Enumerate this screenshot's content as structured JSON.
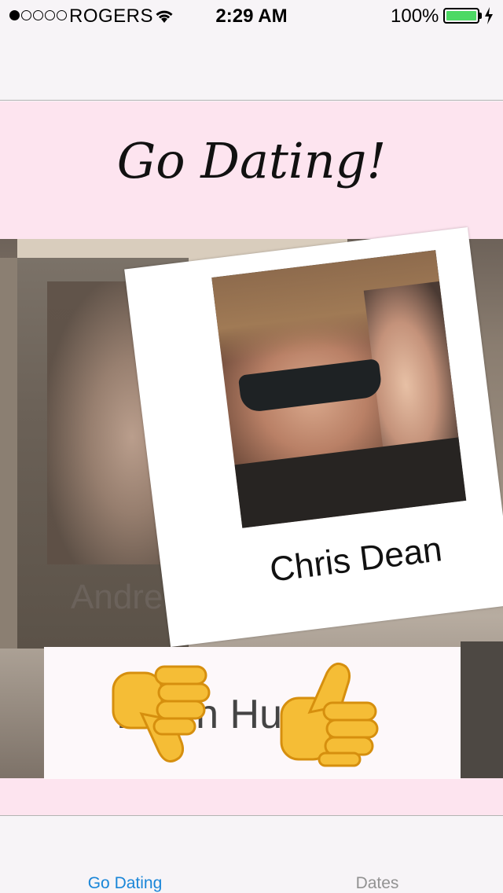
{
  "status_bar": {
    "carrier": "ROGERS",
    "time": "2:29 AM",
    "battery": "100%",
    "signal_bars": 1,
    "signal_total": 5
  },
  "header": {
    "title": "Go Dating!"
  },
  "cards": {
    "front_name": "Chris Dean",
    "back_name": "Andre",
    "bottom_name": "Kevin Huang"
  },
  "actions": {
    "dislike_icon": "thumbs-down-icon",
    "like_icon": "thumbs-up-icon"
  },
  "tab_bar": {
    "tabs": [
      {
        "label": "Go Dating",
        "active": true
      },
      {
        "label": "Dates",
        "active": false
      }
    ]
  },
  "colors": {
    "accent": "#1a86d8",
    "header_pink": "#fde4ef",
    "battery_green": "#4cd964"
  }
}
